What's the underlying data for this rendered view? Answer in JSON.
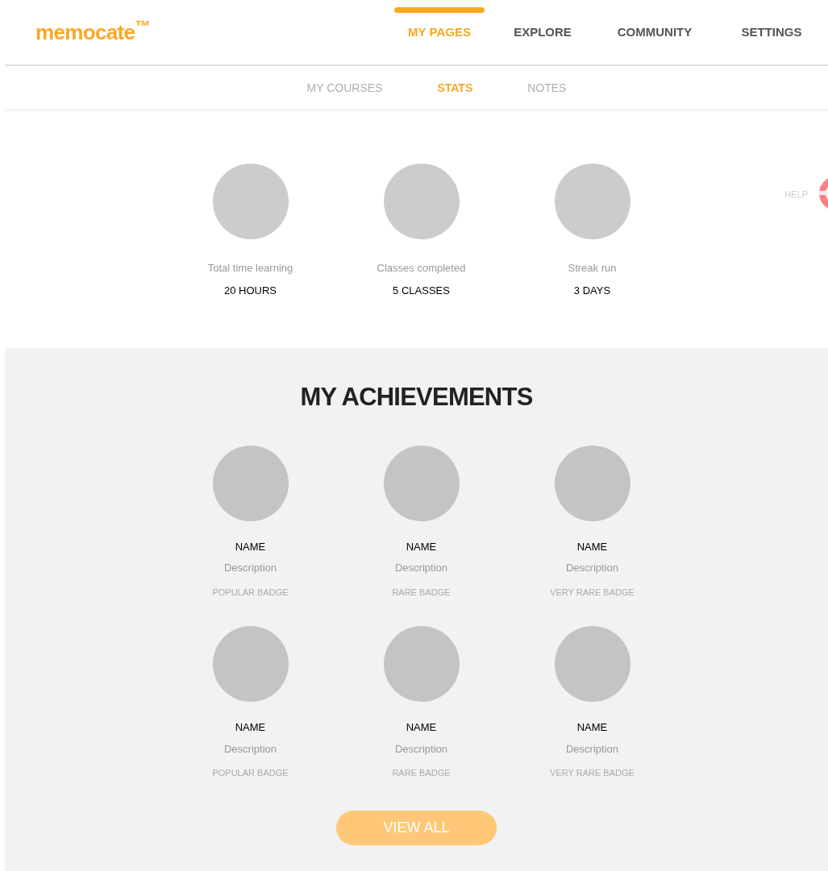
{
  "logo": "memocate$^{™}$",
  "nav": [
    {
      "label": "MY PAGES",
      "selected": true
    },
    {
      "label": "EXPLORE",
      "selected": false
    },
    {
      "label": "COMMUNITY",
      "selected": false
    },
    {
      "label": "SETTINGS",
      "selected": false
    }
  ],
  "subnav": [
    {
      "label": "MY COURSES",
      "selected": false
    },
    {
      "label": "STATS",
      "selected": true
    },
    {
      "label": "NOTES",
      "selected": false
    }
  ],
  "help": "HELP",
  "stats": [
    {
      "label": "Total time learning",
      "value": "20 HOURS"
    },
    {
      "label": "Classes completed",
      "value": "5 CLASSES"
    },
    {
      "label": "Streak run",
      "value": "3 DAYS"
    }
  ],
  "achievements": {
    "title": "MY ACHIEVEMENTS",
    "badges": [
      {
        "name": "NAME",
        "description": "Description",
        "rarity": "POPULAR BADGE"
      },
      {
        "name": "NAME",
        "description": "Description",
        "rarity": "RARE BADGE"
      },
      {
        "name": "NAME",
        "description": "Description",
        "rarity": "VERY RARE BADGE"
      },
      {
        "name": "NAME",
        "description": "Description",
        "rarity": "POPULAR BADGE"
      },
      {
        "name": "NAME",
        "description": "Description",
        "rarity": "RARE BADGE"
      },
      {
        "name": "NAME",
        "description": "Description",
        "rarity": "VERY RARE BADGE"
      }
    ],
    "button": "VIEW ALL"
  }
}
